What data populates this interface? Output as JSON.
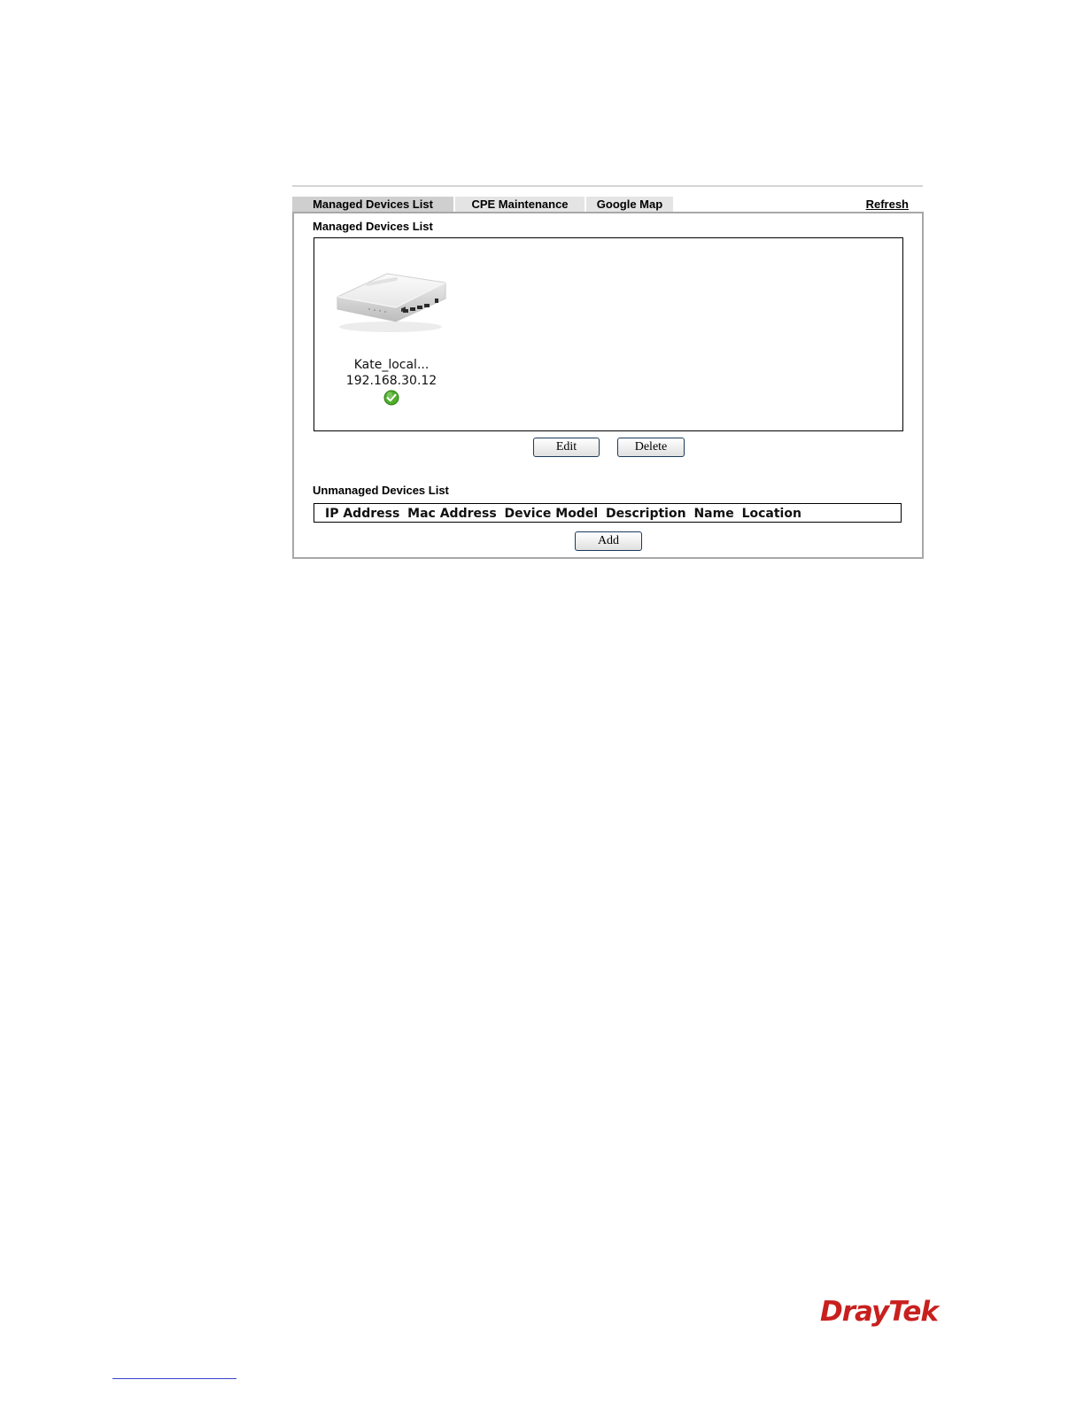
{
  "tabs": [
    {
      "label": "Managed Devices List",
      "active": true
    },
    {
      "label": "CPE Maintenance",
      "active": false
    },
    {
      "label": "Google Map",
      "active": false
    }
  ],
  "refresh_label": "Refresh",
  "managed": {
    "title": "Managed Devices List",
    "devices": [
      {
        "name": "Kate_local...",
        "ip": "192.168.30.12",
        "status": "online",
        "icon": "router-image"
      }
    ],
    "edit_label": "Edit",
    "delete_label": "Delete"
  },
  "unmanaged": {
    "title": "Unmanaged Devices List",
    "columns": [
      "IP Address",
      "Mac Address",
      "Device Model",
      "Description",
      "Name",
      "Location"
    ],
    "add_label": "Add"
  },
  "brand": {
    "name": "DrayTek",
    "color": "#c8201e"
  },
  "colors": {
    "active_tab": "#cfcfcf",
    "inactive_tab": "#e4e4e4",
    "status_ok": "#4caf2a"
  }
}
